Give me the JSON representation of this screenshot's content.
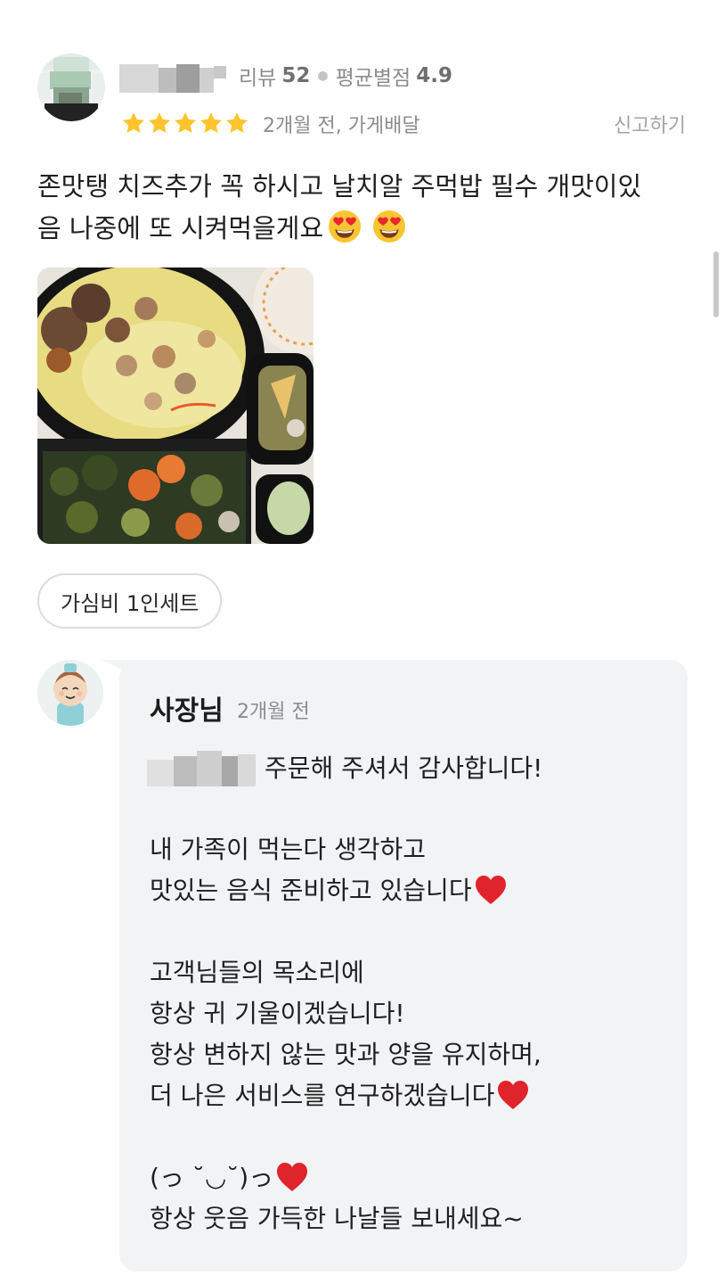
{
  "review": {
    "reviewer_stats": {
      "review_label": "리뷰",
      "review_count": "52",
      "rating_label": "평균별점",
      "rating_avg": "4.9"
    },
    "rating_stars": 5,
    "date_line": "2개월 전, 가게배달",
    "report_label": "신고하기",
    "text_line1": "존맛탱 치즈추가 꼭 하시고 날치알 주먹밥 필수 개맛이있",
    "text_line2": "음 나중에 또 시켜먹을게요",
    "emojis": [
      "heart-eyes-emoji",
      "heart-eyes-emoji"
    ],
    "ordered_menu": "가심비 1인세트"
  },
  "owner_reply": {
    "name": "사장님",
    "date": "2개월 전",
    "greeting": "주문해 주셔서 감사합니다!",
    "lines": [
      "",
      "내 가족이 먹는다 생각하고",
      "맛있는 음식 준비하고 있습니다",
      "",
      "고객님들의 목소리에",
      "항상 귀 기울이겠습니다!",
      "항상 변하지 않는 맛과 양을 유지하며,",
      "더 나은 서비스를 연구하겠습니다",
      "",
      "(っ ˘◡˘)っ",
      "항상 웃음 가득한 나날들 보내세요~"
    ]
  },
  "colors": {
    "star": "#fdc42d",
    "heart": "#e0242c",
    "bubble": "#f2f3f5",
    "muted_text": "#8c8c8c"
  }
}
